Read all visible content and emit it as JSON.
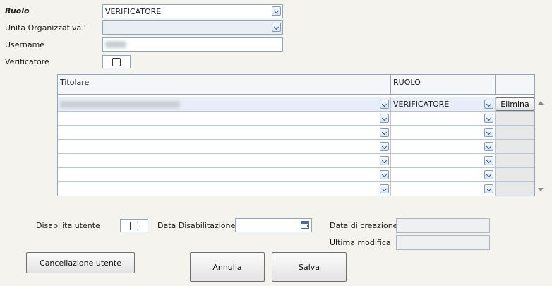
{
  "form": {
    "ruolo_label": "Ruolo",
    "ruolo_value": "VERIFICATORE",
    "unita_label": "Unita Organizzativa '",
    "unita_value": "",
    "username_label": "Username",
    "verificatore_label": "Verificatore"
  },
  "grid": {
    "headers": [
      "Titolare",
      "RUOLO"
    ],
    "rows": [
      {
        "titolare": "",
        "ruolo": "VERIFICATORE",
        "action": "Elimina"
      },
      {
        "titolare": "",
        "ruolo": "",
        "action": ""
      },
      {
        "titolare": "",
        "ruolo": "",
        "action": ""
      },
      {
        "titolare": "",
        "ruolo": "",
        "action": ""
      },
      {
        "titolare": "",
        "ruolo": "",
        "action": ""
      },
      {
        "titolare": "",
        "ruolo": "",
        "action": ""
      },
      {
        "titolare": "",
        "ruolo": "",
        "action": ""
      }
    ]
  },
  "bottom": {
    "disabilita_label": "Disabilita utente",
    "data_disab_label": "Data Disabilitazione",
    "data_creazione_label": "Data di creazione",
    "ultima_modifica_label": "Ultima modifica"
  },
  "buttons": {
    "cancellazione": "Cancellazione utente",
    "annulla": "Annulla",
    "salva": "Salva"
  },
  "icons": [
    "chevron-down-icon",
    "calendar-icon",
    "scroll-up-icon",
    "scroll-down-icon"
  ]
}
